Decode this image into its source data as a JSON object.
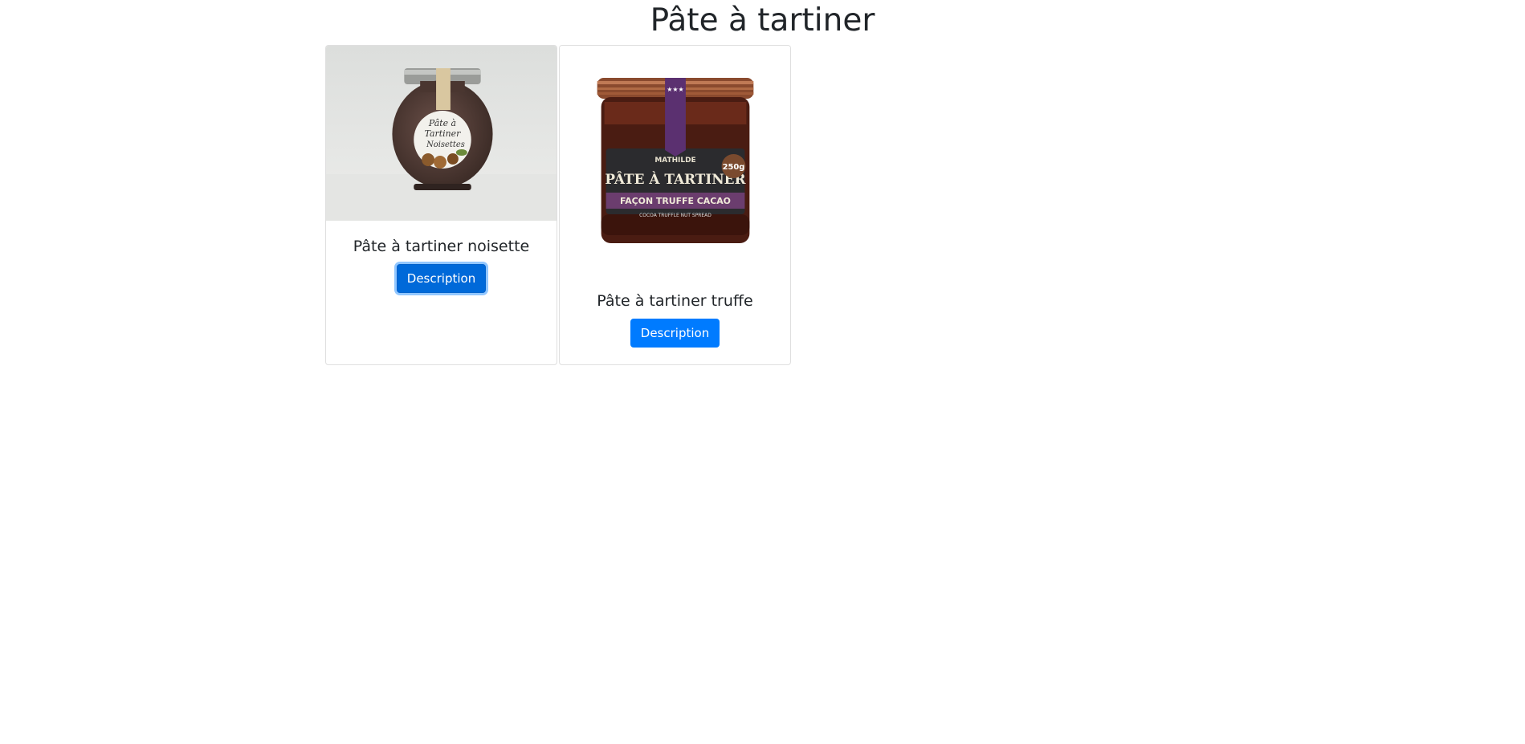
{
  "page": {
    "title": "Pâte à tartiner"
  },
  "products": [
    {
      "name": "Pâte à tartiner noisette",
      "button_label": "Description",
      "image_icon": "hazelnut-spread-jar",
      "label_text": "Pâte à Tartiner Noisettes"
    },
    {
      "name": "Pâte à tartiner truffe",
      "button_label": "Description",
      "image_icon": "truffle-spread-jar",
      "label_brand": "MATHILDE",
      "label_title": "PÂTE À TARTINER",
      "label_subtitle": "FAÇON TRUFFE CACAO",
      "label_note": "COCOA TRUFFLE NUT SPREAD",
      "label_weight": "250g"
    }
  ],
  "colors": {
    "primary": "#007bff",
    "text": "#212529"
  }
}
